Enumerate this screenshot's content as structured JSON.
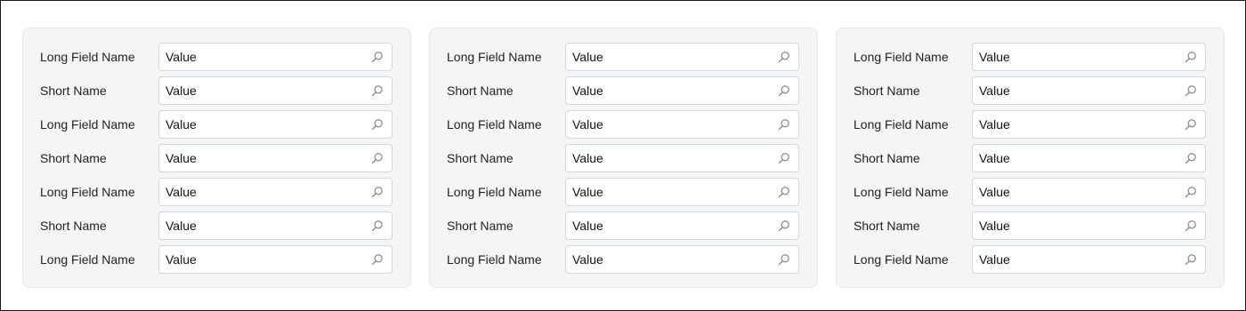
{
  "panels": [
    {
      "rows": [
        {
          "label": "Long Field Name",
          "value": "Value"
        },
        {
          "label": "Short Name",
          "value": "Value"
        },
        {
          "label": "Long Field Name",
          "value": "Value"
        },
        {
          "label": "Short Name",
          "value": "Value"
        },
        {
          "label": "Long Field Name",
          "value": "Value"
        },
        {
          "label": "Short Name",
          "value": "Value"
        },
        {
          "label": "Long Field Name",
          "value": "Value"
        }
      ]
    },
    {
      "rows": [
        {
          "label": "Long Field Name",
          "value": "Value"
        },
        {
          "label": "Short Name",
          "value": "Value"
        },
        {
          "label": "Long Field Name",
          "value": "Value"
        },
        {
          "label": "Short Name",
          "value": "Value"
        },
        {
          "label": "Long Field Name",
          "value": "Value"
        },
        {
          "label": "Short Name",
          "value": "Value"
        },
        {
          "label": "Long Field Name",
          "value": "Value"
        }
      ]
    },
    {
      "rows": [
        {
          "label": "Long Field Name",
          "value": "Value"
        },
        {
          "label": "Short Name",
          "value": "Value"
        },
        {
          "label": "Long Field Name",
          "value": "Value"
        },
        {
          "label": "Short Name",
          "value": "Value"
        },
        {
          "label": "Long Field Name",
          "value": "Value"
        },
        {
          "label": "Short Name",
          "value": "Value"
        },
        {
          "label": "Long Field Name",
          "value": "Value"
        }
      ]
    }
  ],
  "icons": {
    "field_icon": "search-icon"
  },
  "colors": {
    "panel_bg": "#f4f5f7",
    "field_border": "#d4d7dc",
    "frame_border": "#1a1a1a"
  }
}
